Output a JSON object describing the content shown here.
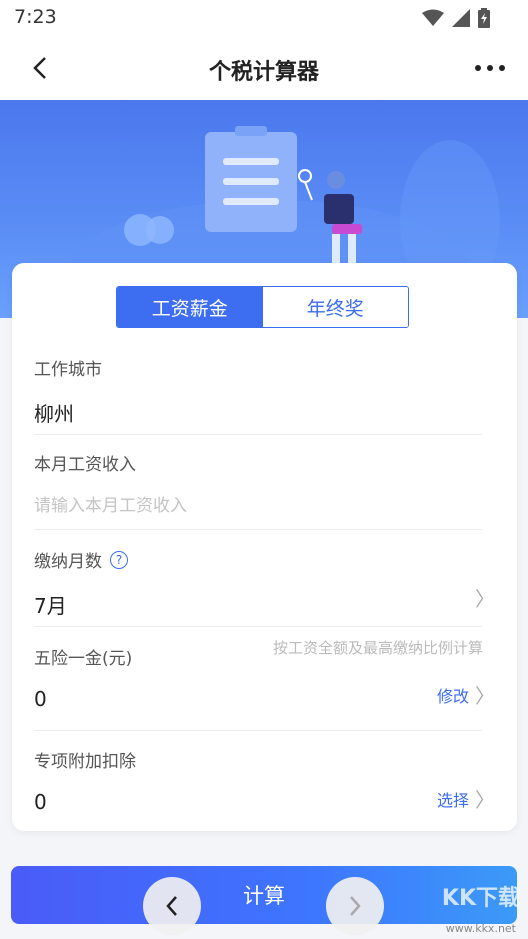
{
  "status": {
    "time": "7:23"
  },
  "appbar": {
    "title": "个税计算器"
  },
  "tabs": [
    {
      "label": "工资薪金"
    },
    {
      "label": "年终奖"
    }
  ],
  "fields": {
    "city": {
      "label": "工作城市",
      "value": "柳州"
    },
    "income": {
      "label": "本月工资收入",
      "placeholder": "请输入本月工资收入"
    },
    "months": {
      "label": "缴纳月数",
      "value": "7月"
    },
    "insurance": {
      "label": "五险一金(元)",
      "value": "0",
      "hint": "按工资全额及最高缴纳比例计算",
      "action": "修改"
    },
    "deduction": {
      "label": "专项附加扣除",
      "value": "0",
      "action": "选择"
    }
  },
  "calculate_label": "计算",
  "watermark": {
    "brand": "KK下载",
    "url": "www.kkx.net"
  },
  "colors": {
    "accent": "#3d6df1",
    "banner": "#5a8cf5"
  }
}
